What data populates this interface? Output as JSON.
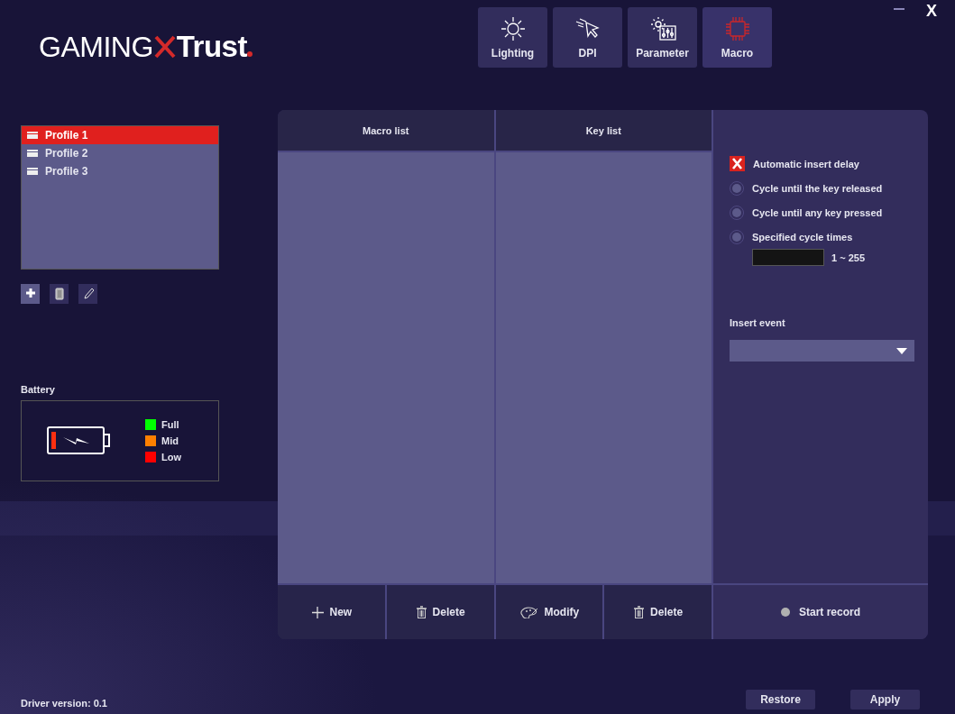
{
  "logo": {
    "wordmark_left": "GAMING",
    "wordmark_right": "Trust"
  },
  "window_controls": {
    "close": "X"
  },
  "tabs": [
    {
      "label": "Lighting",
      "kind": "sun",
      "selected": false
    },
    {
      "label": "DPI",
      "kind": "cursor",
      "selected": false
    },
    {
      "label": "Parameter",
      "kind": "gear",
      "selected": false
    },
    {
      "label": "Macro",
      "kind": "chip",
      "selected": true
    }
  ],
  "profiles": [
    {
      "label": "Profile 1",
      "selected": true
    },
    {
      "label": "Profile 2",
      "selected": false
    },
    {
      "label": "Profile 3",
      "selected": false
    }
  ],
  "battery": {
    "title": "Battery",
    "legend": [
      {
        "label": "Full",
        "color": "#00ff00"
      },
      {
        "label": "Mid",
        "color": "#ff8000"
      },
      {
        "label": "Low",
        "color": "#ff0000"
      }
    ]
  },
  "macro_panel": {
    "columns": [
      "Macro list",
      "Key list"
    ],
    "buttons": [
      {
        "label": "New",
        "kind": "plus"
      },
      {
        "label": "Delete",
        "kind": "trash"
      },
      {
        "label": "Modify",
        "kind": "palette"
      },
      {
        "label": "Delete",
        "kind": "trash"
      }
    ],
    "auto_delay": {
      "label": "Automatic insert delay",
      "checked": true
    },
    "cycle_options": [
      {
        "label": "Cycle until the key released",
        "selected": false
      },
      {
        "label": "Cycle until any key pressed",
        "selected": false
      },
      {
        "label": "Specified cycle times",
        "selected": false
      }
    ],
    "cycle_range": "1 ~ 255",
    "insert_event": {
      "label": "Insert event"
    },
    "start_record": "Start record"
  },
  "footer": {
    "driver_version": "Driver version: 0.1",
    "buttons": [
      "Restore",
      "Apply"
    ]
  }
}
